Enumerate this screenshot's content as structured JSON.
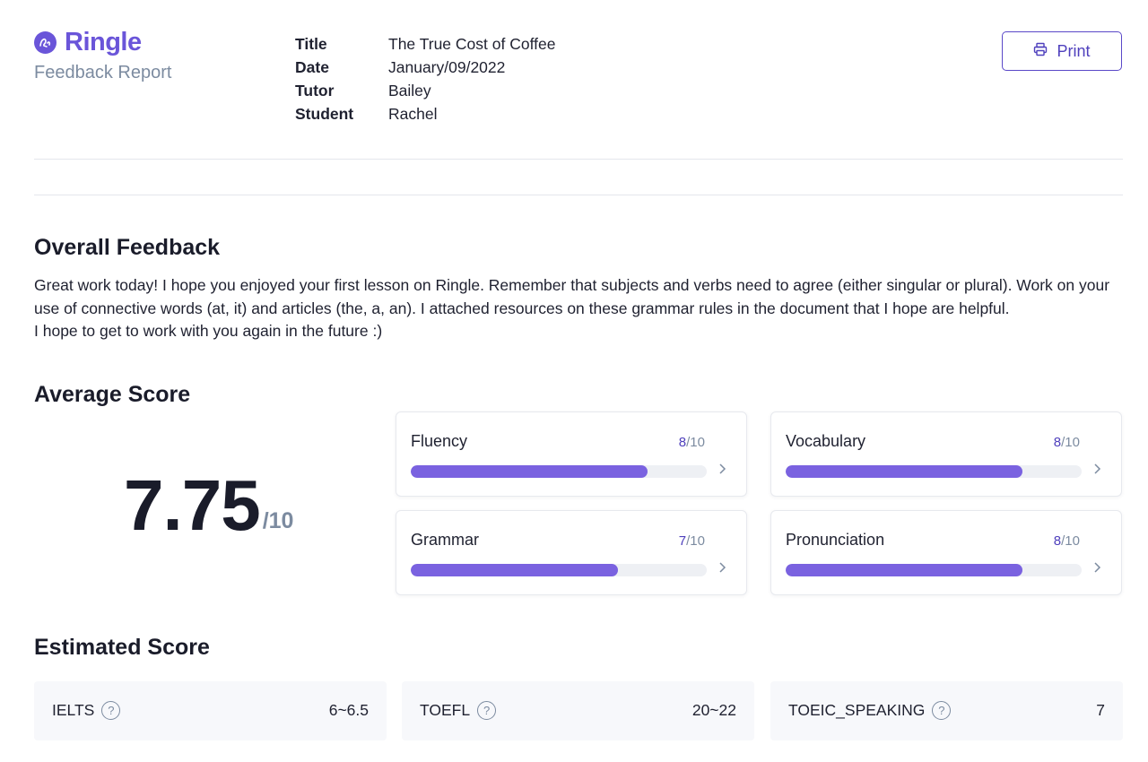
{
  "brand": {
    "name": "Ringle",
    "subtitle": "Feedback Report"
  },
  "meta": [
    {
      "key": "Title",
      "value": "The True Cost of Coffee"
    },
    {
      "key": "Date",
      "value": "January/09/2022"
    },
    {
      "key": "Tutor",
      "value": "Bailey"
    },
    {
      "key": "Student",
      "value": "Rachel"
    }
  ],
  "print_label": "Print",
  "overall": {
    "title": "Overall Feedback",
    "lines": [
      "Great work today! I hope you enjoyed your first lesson on Ringle. Remember that subjects and verbs need to agree (either singular or plural). Work on your use of connective words (at, it) and articles (the, a, an). I attached resources on these grammar rules in the document that I hope are helpful.",
      "I hope to get to work with you again in the future :)"
    ]
  },
  "average": {
    "title": "Average Score",
    "value": "7.75",
    "denominator": "/10",
    "cards": [
      {
        "label": "Fluency",
        "score": "8",
        "max": "/10",
        "fraction": 0.8
      },
      {
        "label": "Vocabulary",
        "score": "8",
        "max": "/10",
        "fraction": 0.8
      },
      {
        "label": "Grammar",
        "score": "7",
        "max": "/10",
        "fraction": 0.7
      },
      {
        "label": "Pronunciation",
        "score": "8",
        "max": "/10",
        "fraction": 0.8
      }
    ]
  },
  "estimated": {
    "title": "Estimated Score",
    "items": [
      {
        "label": "IELTS",
        "value": "6~6.5"
      },
      {
        "label": "TOEFL",
        "value": "20~22"
      },
      {
        "label": "TOEIC_SPEAKING",
        "value": "7"
      }
    ]
  },
  "icons": {
    "logo": "ringle-logo-icon",
    "print": "printer-icon",
    "help": "question-circle-icon",
    "chevron": "chevron-right-icon"
  },
  "colors": {
    "accent": "#6a55d9",
    "bar": "#7a62e0",
    "muted": "#7c8ba0"
  }
}
